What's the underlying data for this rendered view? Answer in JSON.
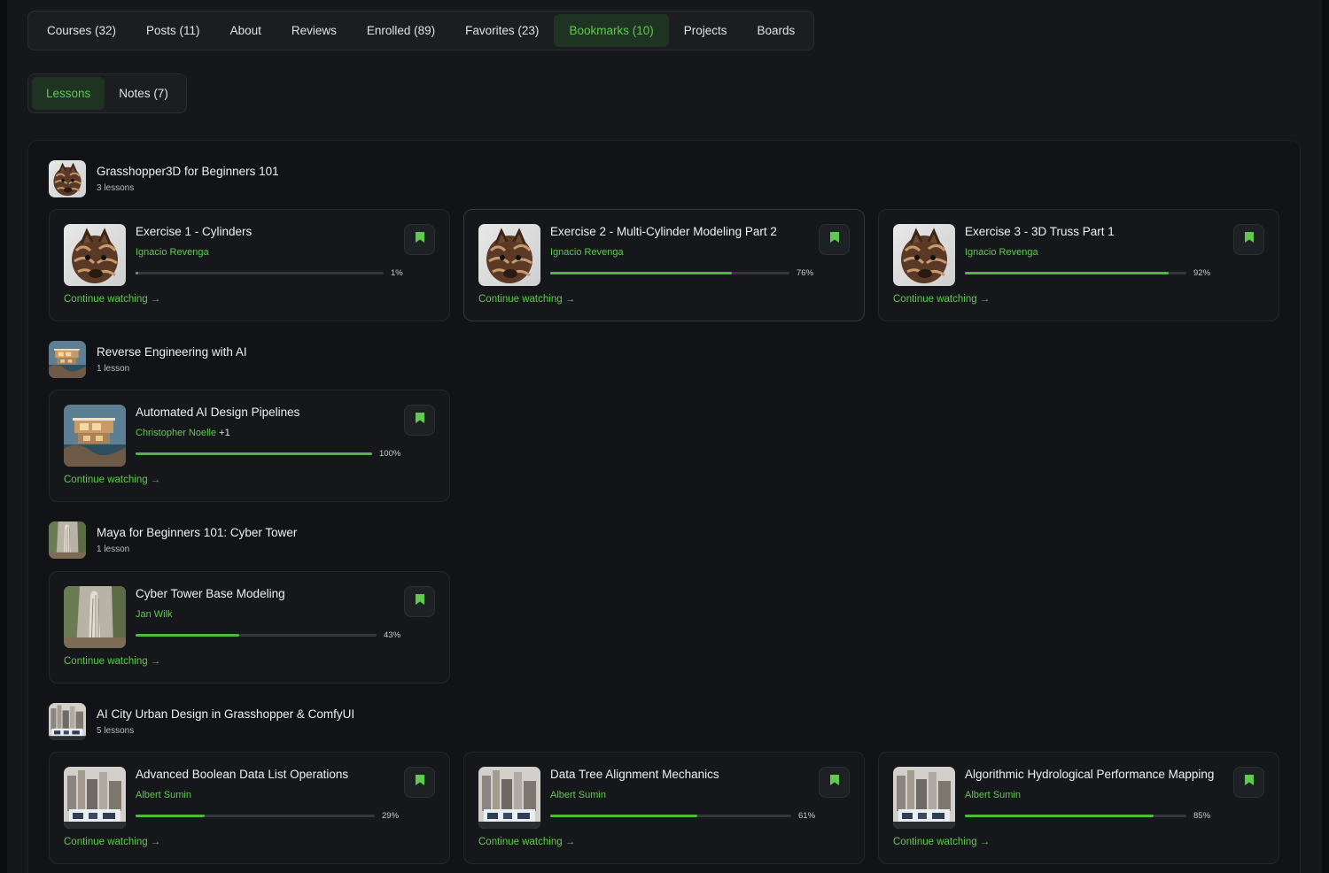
{
  "tabs": [
    {
      "label": "Courses (32)"
    },
    {
      "label": "Posts (11)"
    },
    {
      "label": "About"
    },
    {
      "label": "Reviews"
    },
    {
      "label": "Enrolled (89)"
    },
    {
      "label": "Favorites (23)"
    },
    {
      "label": "Bookmarks (10)",
      "active": true
    },
    {
      "label": "Projects"
    },
    {
      "label": "Boards"
    }
  ],
  "subtabs": [
    {
      "label": "Lessons",
      "active": true
    },
    {
      "label": "Notes (7)"
    }
  ],
  "continue_label": "Continue watching →",
  "colors": {
    "accent": "#5fca4e",
    "background": "#15171b",
    "card": "#15171a"
  },
  "courses": [
    {
      "title": "Grasshopper3D for Beginners 101",
      "count": "3 lessons",
      "thumb": "zebra",
      "lessons": [
        {
          "title": "Exercise 1 - Cylinders",
          "author": "Ignacio Revenga",
          "extra": "",
          "progress_label": "1%",
          "progress": 0.01,
          "thumb": "zebra"
        },
        {
          "title": "Exercise 2 - Multi-Cylinder Modeling Part 2",
          "author": "Ignacio Revenga",
          "extra": "",
          "progress_label": "76%",
          "progress": 0.76,
          "thumb": "zebra"
        },
        {
          "title": "Exercise 3 - 3D Truss Part 1",
          "author": "Ignacio Revenga",
          "extra": "",
          "progress_label": "92%",
          "progress": 0.92,
          "thumb": "zebra"
        }
      ]
    },
    {
      "title": "Reverse Engineering with AI",
      "count": "1 lesson",
      "thumb": "house",
      "lessons": [
        {
          "title": "Automated AI Design Pipelines",
          "author": "Christopher Noelle",
          "extra": "+1",
          "progress_label": "100%",
          "progress": 1.0,
          "thumb": "house"
        }
      ]
    },
    {
      "title": "Maya for Beginners 101: Cyber Tower",
      "count": "1 lesson",
      "thumb": "tower",
      "lessons": [
        {
          "title": "Cyber Tower Base Modeling",
          "author": "Jan Wilk",
          "extra": "",
          "progress_label": "43%",
          "progress": 0.43,
          "thumb": "tower"
        }
      ]
    },
    {
      "title": "AI City Urban Design in Grasshopper & ComfyUI",
      "count": "5 lessons",
      "thumb": "city",
      "lessons": [
        {
          "title": "Advanced Boolean Data List Operations",
          "author": "Albert Sumin",
          "extra": "",
          "progress_label": "29%",
          "progress": 0.29,
          "thumb": "city"
        },
        {
          "title": "Data Tree Alignment Mechanics",
          "author": "Albert Sumin",
          "extra": "",
          "progress_label": "61%",
          "progress": 0.61,
          "thumb": "city"
        },
        {
          "title": "Algorithmic Hydrological Performance Mapping",
          "author": "Albert Sumin",
          "extra": "",
          "progress_label": "85%",
          "progress": 0.85,
          "thumb": "city"
        }
      ]
    }
  ]
}
